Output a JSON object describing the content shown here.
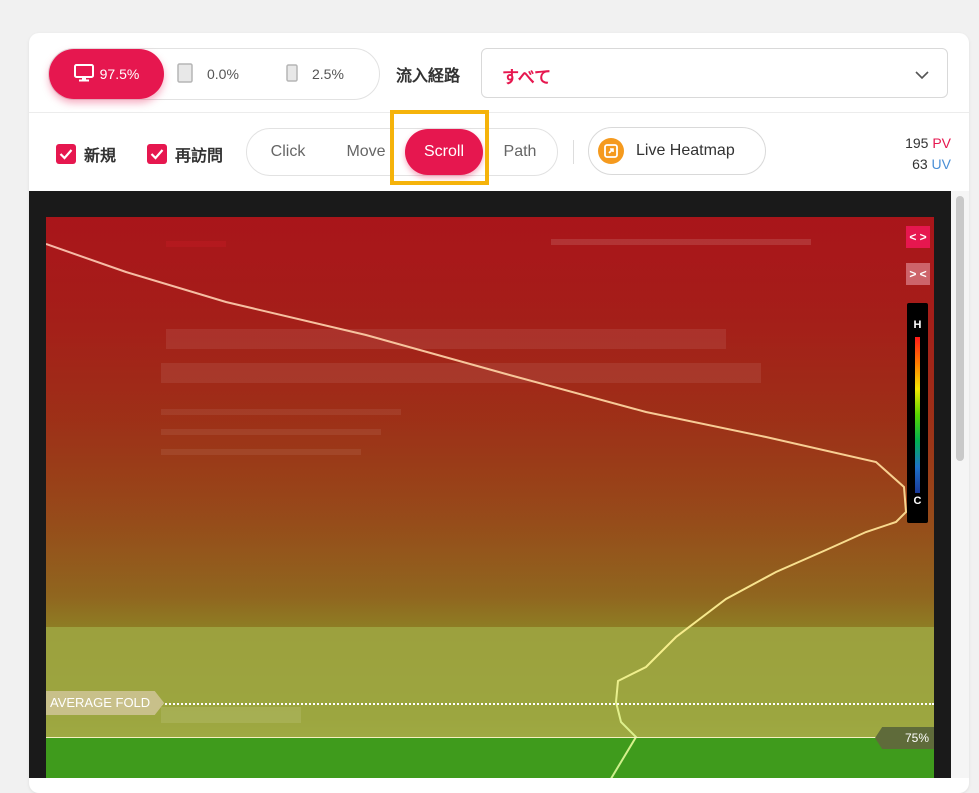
{
  "devices": [
    {
      "name": "desktop",
      "percent": "97.5%",
      "active": true
    },
    {
      "name": "tablet",
      "percent": "0.0%",
      "active": false
    },
    {
      "name": "mobile",
      "percent": "2.5%",
      "active": false
    }
  ],
  "source": {
    "label": "流入経路",
    "selected": "すべて"
  },
  "filters": {
    "new_label": "新規",
    "returning_label": "再訪問"
  },
  "modes": [
    "Click",
    "Move",
    "Scroll",
    "Path"
  ],
  "active_mode": "Scroll",
  "live_heatmap_label": "Live Heatmap",
  "stats": {
    "pv_value": "195",
    "pv_unit": "PV",
    "uv_value": "63",
    "uv_unit": "UV"
  },
  "heatmap": {
    "average_fold_label": "AVERAGE FOLD",
    "threshold_label": "75%",
    "legend_high": "H",
    "legend_low": "C",
    "expand_symbol": "< >",
    "collapse_symbol": "> <"
  },
  "colors": {
    "accent": "#e6174f",
    "highlight": "#f5b30a",
    "uv": "#4a8fd6"
  }
}
